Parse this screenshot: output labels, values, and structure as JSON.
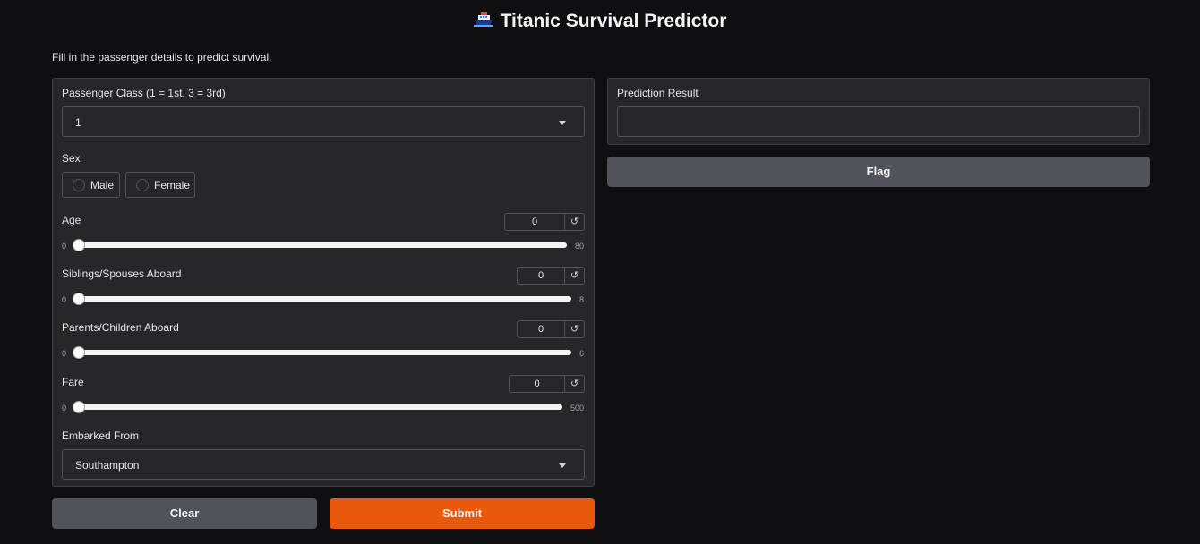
{
  "header": {
    "icon": "ship-icon",
    "title": "Titanic Survival Predictor"
  },
  "description": "Fill in the passenger details to predict survival.",
  "form": {
    "pclass": {
      "label": "Passenger Class (1 = 1st, 3 = 3rd)",
      "value": "1"
    },
    "sex": {
      "label": "Sex",
      "options": [
        "Male",
        "Female"
      ],
      "selected": null
    },
    "age": {
      "label": "Age",
      "value": "0",
      "min": "0",
      "max": "80"
    },
    "sibsp": {
      "label": "Siblings/Spouses Aboard",
      "value": "0",
      "min": "0",
      "max": "8"
    },
    "parch": {
      "label": "Parents/Children Aboard",
      "value": "0",
      "min": "0",
      "max": "6"
    },
    "fare": {
      "label": "Fare",
      "value": "0",
      "min": "0",
      "max": "500"
    },
    "embarked": {
      "label": "Embarked From",
      "value": "Southampton"
    },
    "reset_icon": "↺"
  },
  "buttons": {
    "clear": "Clear",
    "submit": "Submit",
    "flag": "Flag"
  },
  "output": {
    "label": "Prediction Result",
    "value": ""
  },
  "colors": {
    "accent": "#ea580c",
    "background": "#0f0f11",
    "panel": "#27272a"
  }
}
